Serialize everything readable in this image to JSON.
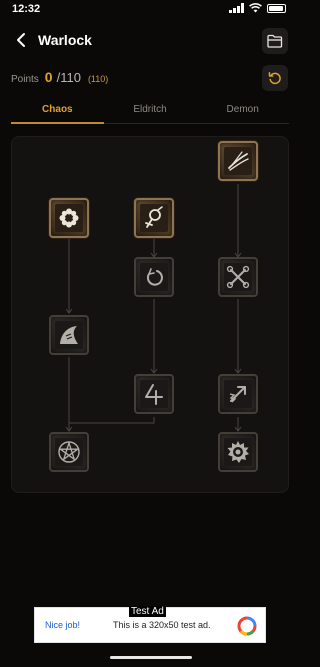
{
  "status": {
    "time": "12:32"
  },
  "header": {
    "title": "Warlock"
  },
  "points": {
    "label": "Points",
    "current": "0",
    "max": "/110",
    "extra": "(110)"
  },
  "tabs": [
    {
      "label": "Chaos",
      "active": true
    },
    {
      "label": "Eldritch",
      "active": false
    },
    {
      "label": "Demon",
      "active": false
    }
  ],
  "tree": {
    "nodes": [
      {
        "name": "flower-sigil",
        "state": "active"
      },
      {
        "name": "venus-rune",
        "state": "active"
      },
      {
        "name": "claw-slash",
        "state": "active"
      },
      {
        "name": "crescent-loop",
        "state": "locked"
      },
      {
        "name": "chain-cross",
        "state": "locked"
      },
      {
        "name": "shark-fin",
        "state": "locked"
      },
      {
        "name": "four-rune",
        "state": "locked"
      },
      {
        "name": "arrow-burst",
        "state": "locked"
      },
      {
        "name": "pentagram",
        "state": "locked"
      },
      {
        "name": "sawblade-sun",
        "state": "locked"
      }
    ]
  },
  "ad": {
    "tag": "Test Ad",
    "left_text": "Nice job!",
    "body_text": "This is a 320x50 test ad."
  },
  "colors": {
    "accent": "#e0a22e",
    "background": "#0a0908",
    "panel": "#141210"
  }
}
